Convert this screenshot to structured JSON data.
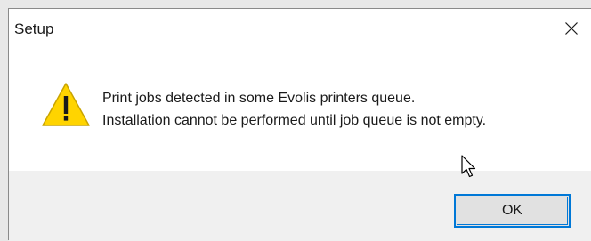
{
  "window": {
    "title": "Setup",
    "close_icon": "close-icon"
  },
  "message": {
    "icon": "warning-icon",
    "line1": "Print jobs detected in some Evolis printers queue.",
    "line2": "Installation cannot be performed until job queue is not empty."
  },
  "buttons": {
    "ok_label": "OK"
  },
  "colors": {
    "accent": "#0078d7",
    "warning_fill": "#ffd400",
    "footer_bg": "#f0f0f0"
  }
}
